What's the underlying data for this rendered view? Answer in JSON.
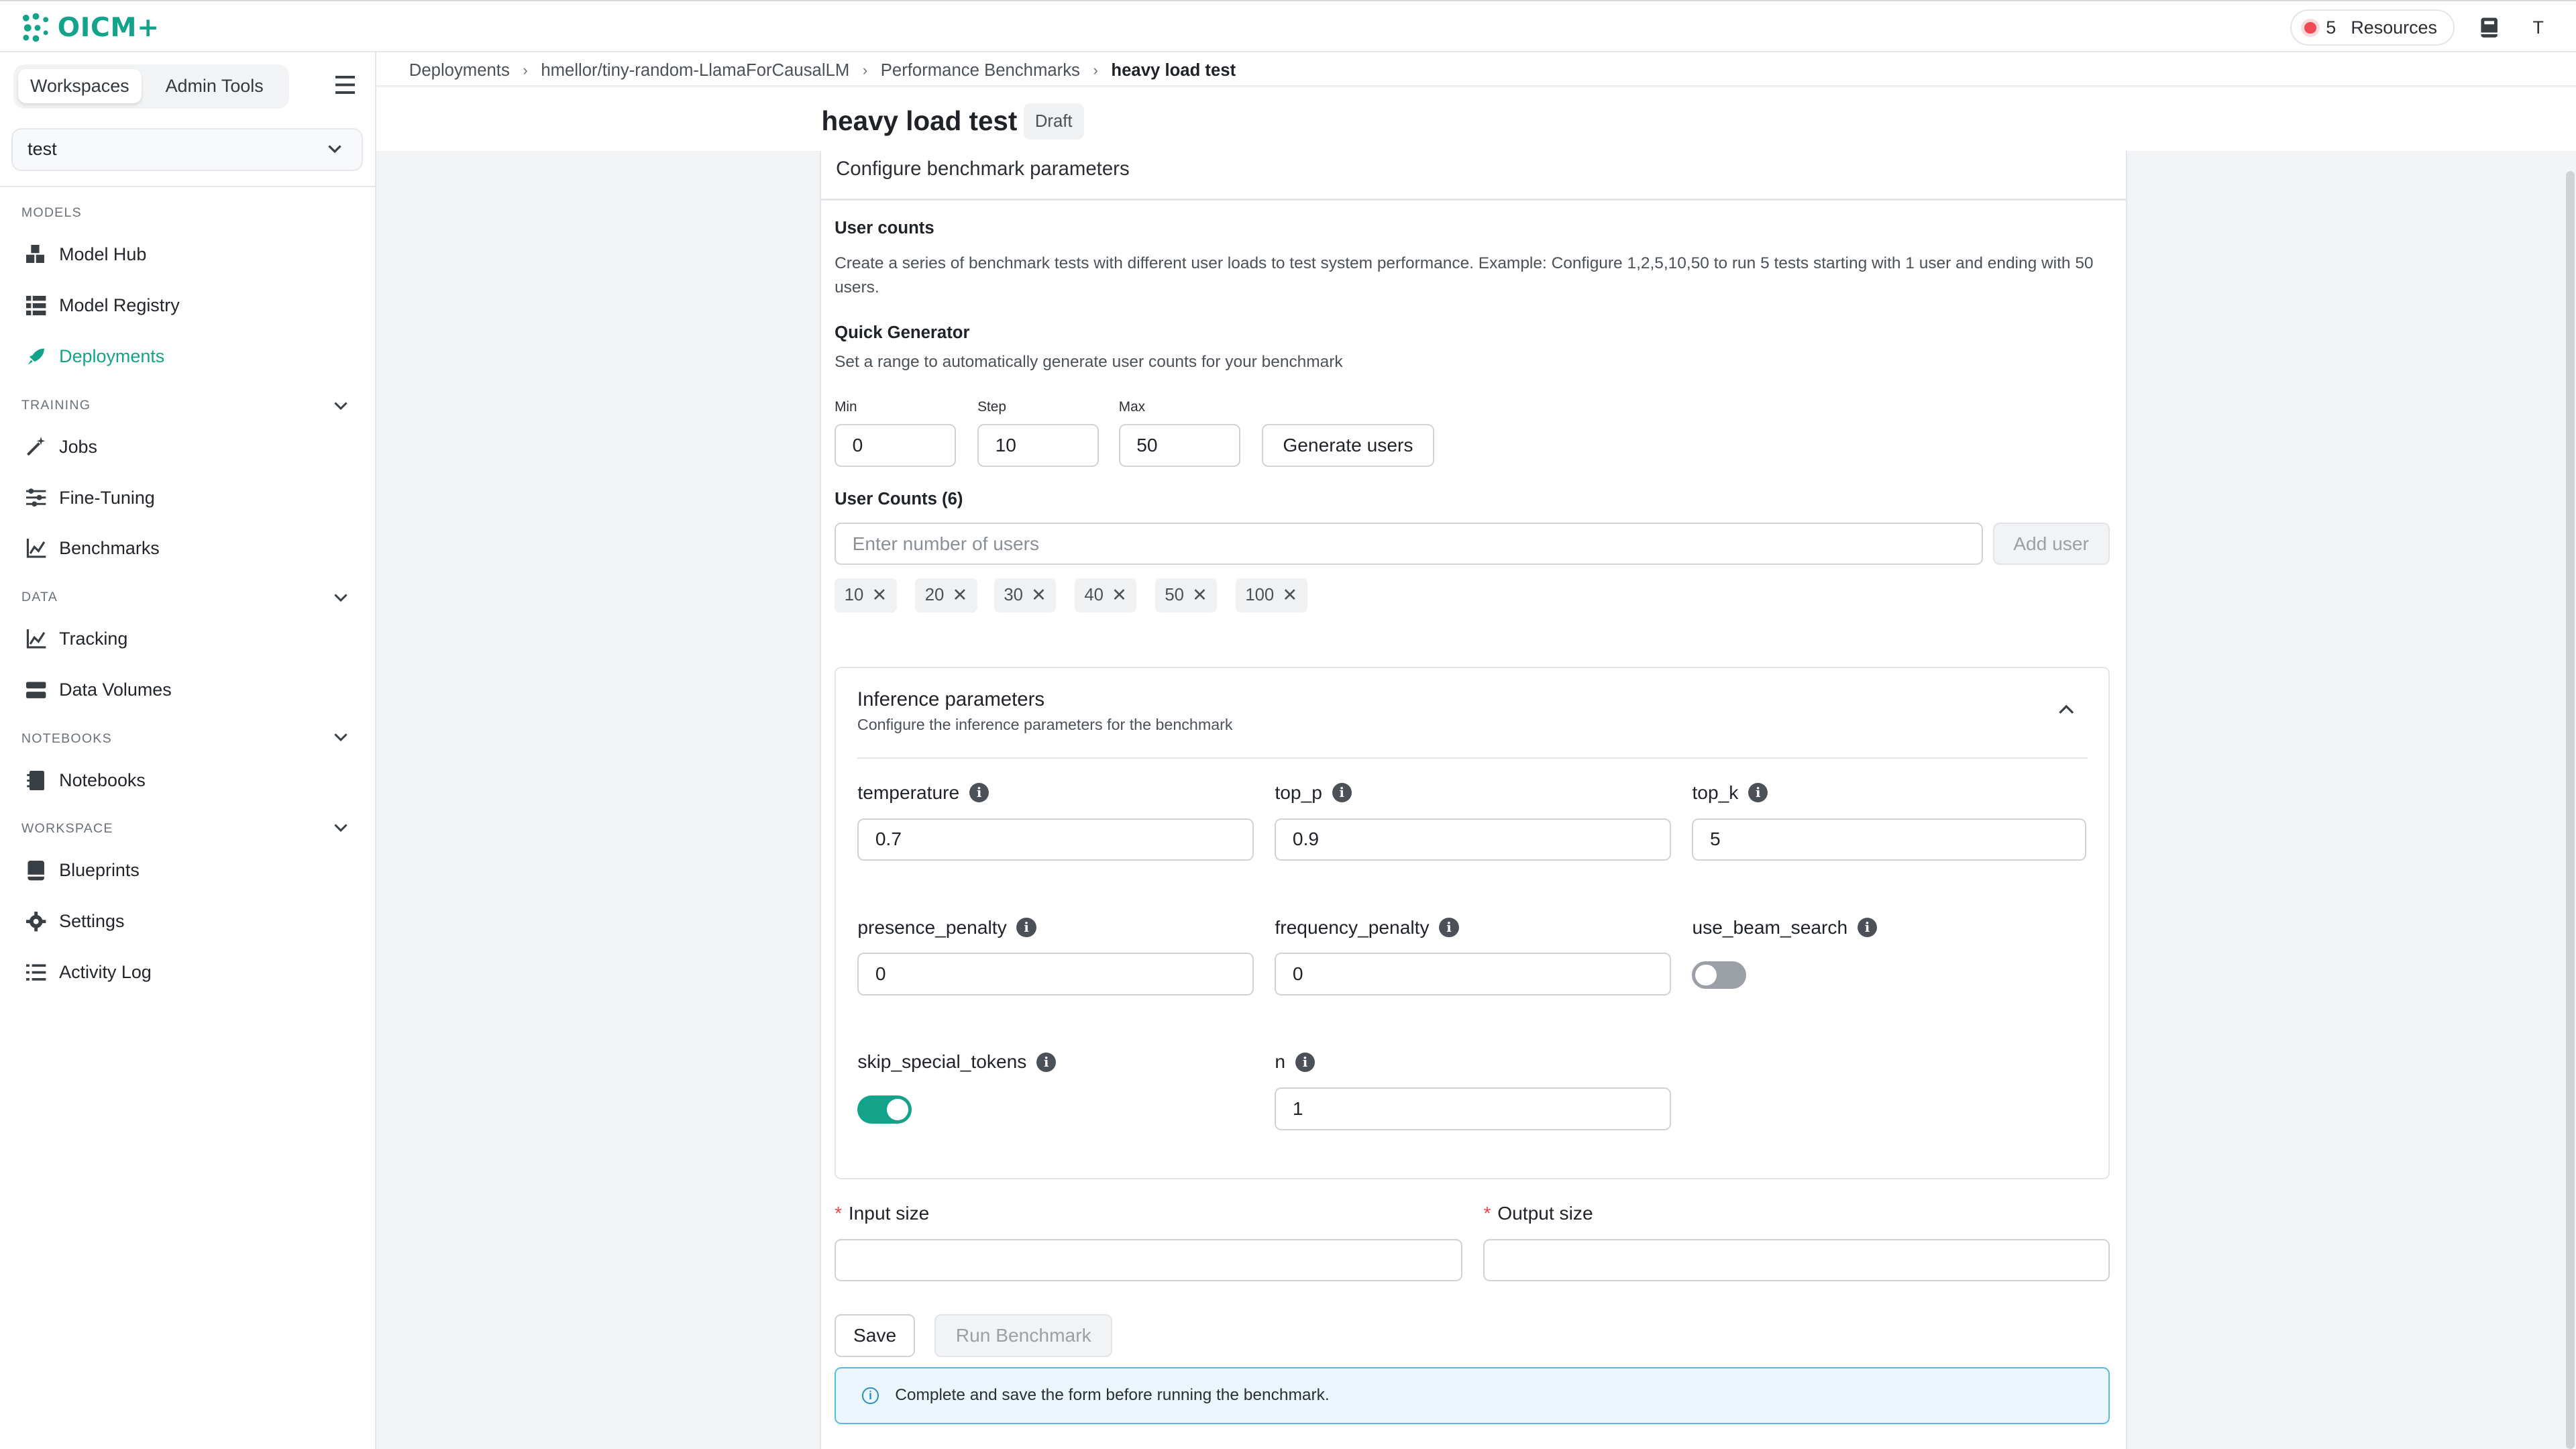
{
  "app": {
    "logo_text": "OICM+",
    "brand_color": "#13a38b"
  },
  "topbar": {
    "resources_count": "5",
    "resources_label": "Resources",
    "avatar_initial": "T"
  },
  "sidebar": {
    "tabs": [
      "Workspaces",
      "Admin Tools"
    ],
    "workspace_selected": "test",
    "sections": [
      {
        "label": "MODELS",
        "items": [
          "Model Hub",
          "Model Registry",
          "Deployments"
        ]
      },
      {
        "label": "TRAINING",
        "items": [
          "Jobs",
          "Fine-Tuning",
          "Benchmarks"
        ]
      },
      {
        "label": "DATA",
        "items": [
          "Tracking",
          "Data Volumes"
        ]
      },
      {
        "label": "NOTEBOOKS",
        "items": [
          "Notebooks"
        ]
      },
      {
        "label": "WORKSPACE",
        "items": [
          "Blueprints",
          "Settings",
          "Activity Log"
        ]
      }
    ],
    "active_item": "Deployments"
  },
  "breadcrumb": [
    "Deployments",
    "hmellor/tiny-random-LlamaForCausalLM",
    "Performance Benchmarks",
    "heavy load test"
  ],
  "page": {
    "title": "heavy load test",
    "status": "Draft"
  },
  "form": {
    "card_title": "Configure benchmark parameters",
    "user_counts_title": "User counts",
    "user_counts_desc": "Create a series of benchmark tests with different user loads to test system performance. Example: Configure 1,2,5,10,50 to run 5 tests starting with 1 user and ending with 50 users.",
    "quick_gen_title": "Quick Generator",
    "quick_gen_desc": "Set a range to automatically generate user counts for your benchmark",
    "min_label": "Min",
    "min_value": "0",
    "step_label": "Step",
    "step_value": "10",
    "max_label": "Max",
    "max_value": "50",
    "generate_button": "Generate users",
    "user_counts_list_title": "User Counts (6)",
    "user_input_placeholder": "Enter number of users",
    "add_user_button": "Add user",
    "chips": [
      "10",
      "20",
      "30",
      "40",
      "50",
      "100"
    ]
  },
  "inference": {
    "title": "Inference parameters",
    "subtitle": "Configure the inference parameters for the benchmark",
    "params": {
      "temperature": {
        "label": "temperature",
        "value": "0.7"
      },
      "top_p": {
        "label": "top_p",
        "value": "0.9"
      },
      "top_k": {
        "label": "top_k",
        "value": "5"
      },
      "presence_penalty": {
        "label": "presence_penalty",
        "value": "0"
      },
      "frequency_penalty": {
        "label": "frequency_penalty",
        "value": "0"
      },
      "use_beam_search": {
        "label": "use_beam_search",
        "enabled": false
      },
      "skip_special_tokens": {
        "label": "skip_special_tokens",
        "enabled": true
      },
      "n": {
        "label": "n",
        "value": "1"
      }
    }
  },
  "sizes": {
    "input_label": "Input size",
    "input_value": "",
    "output_label": "Output size",
    "output_value": ""
  },
  "actions": {
    "save": "Save",
    "run": "Run Benchmark"
  },
  "alert": {
    "text": "Complete and save the form before running the benchmark."
  }
}
